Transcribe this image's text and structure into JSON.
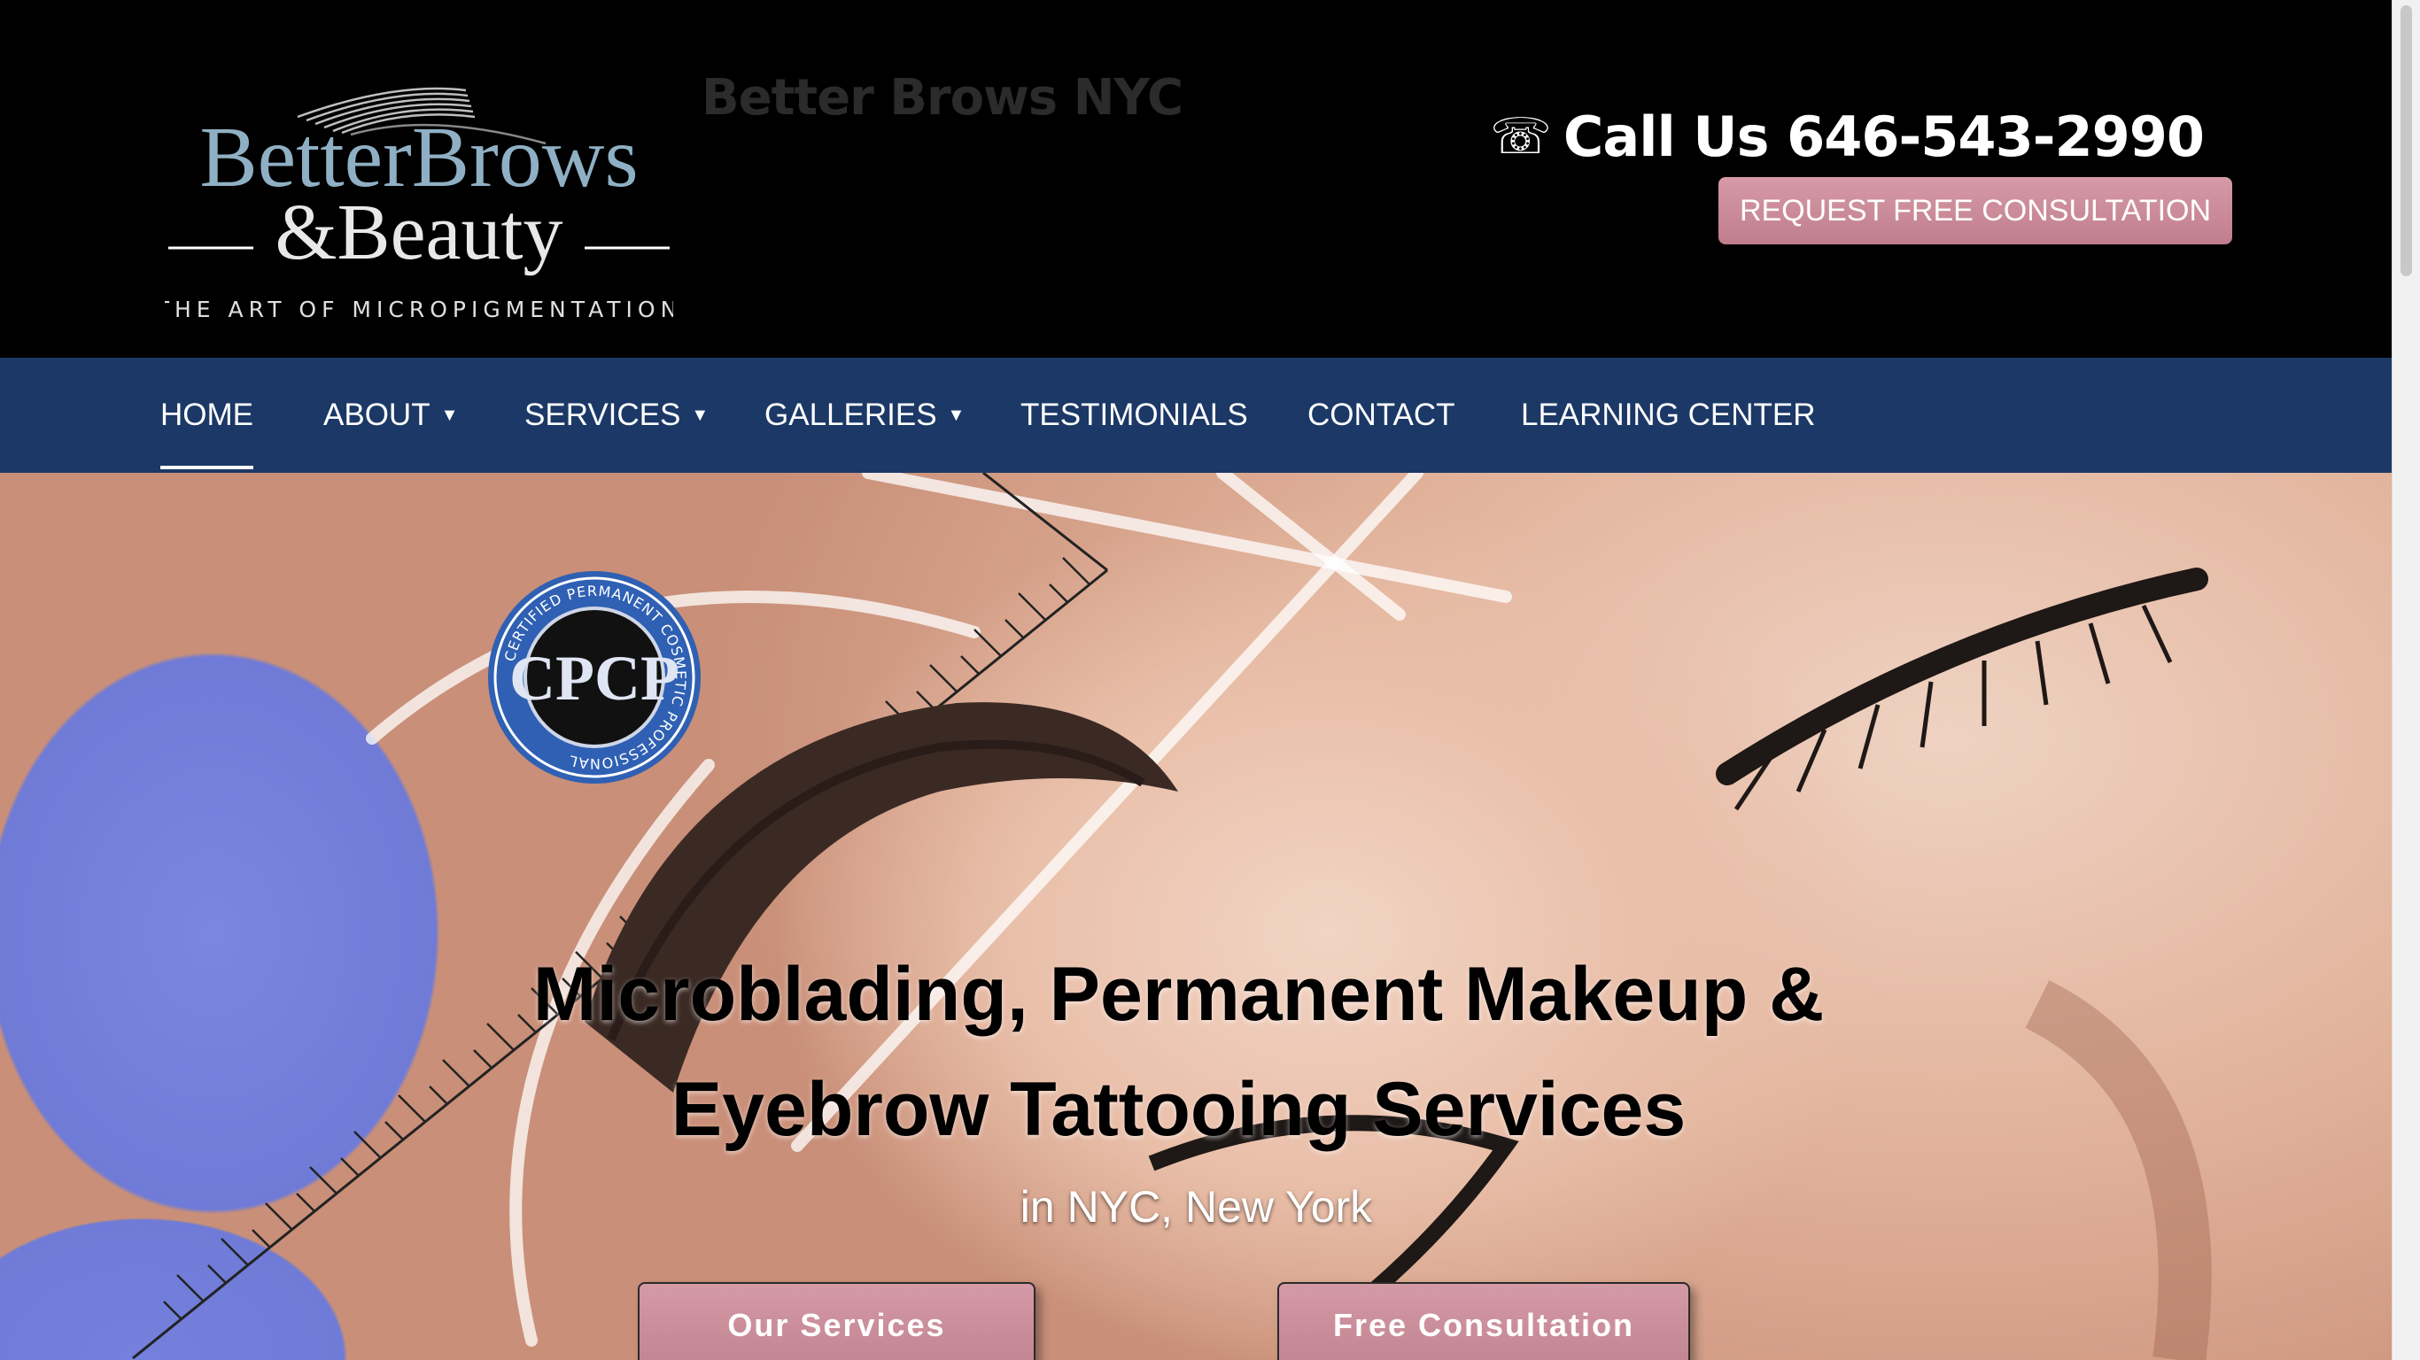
{
  "header": {
    "logo": {
      "line1": "BetterBrows",
      "line2": "&Beauty",
      "tagline": "THE ART OF MICROPIGMENTATION"
    },
    "site_name": "Better Brows NYC",
    "phone_icon": "☏",
    "call_text": "Call Us 646-543-2990",
    "consult_button": "REQUEST FREE CONSULTATION",
    "accent_color": "#c98694"
  },
  "nav": {
    "background": "#1b3866",
    "items": [
      {
        "label": "HOME",
        "active": true
      },
      {
        "label": "ABOUT",
        "dropdown": true
      },
      {
        "label": "SERVICES",
        "dropdown": true
      },
      {
        "label": "GALLERIES",
        "dropdown": true
      },
      {
        "label": "TESTIMONIALS"
      },
      {
        "label": "CONTACT"
      },
      {
        "label": "LEARNING CENTER"
      }
    ],
    "caret": "▼"
  },
  "hero": {
    "badge": {
      "ring_text": "CERTIFIED PERMANENT COSMETIC PROFESSIONAL",
      "center": "CPCP"
    },
    "headline_line1": "Microblading, Permanent Makeup &",
    "headline_line2": "Eyebrow Tattooing Services",
    "subline": "in NYC, New York",
    "buttons": {
      "services": "Our Services",
      "consult": "Free Consultation"
    }
  }
}
